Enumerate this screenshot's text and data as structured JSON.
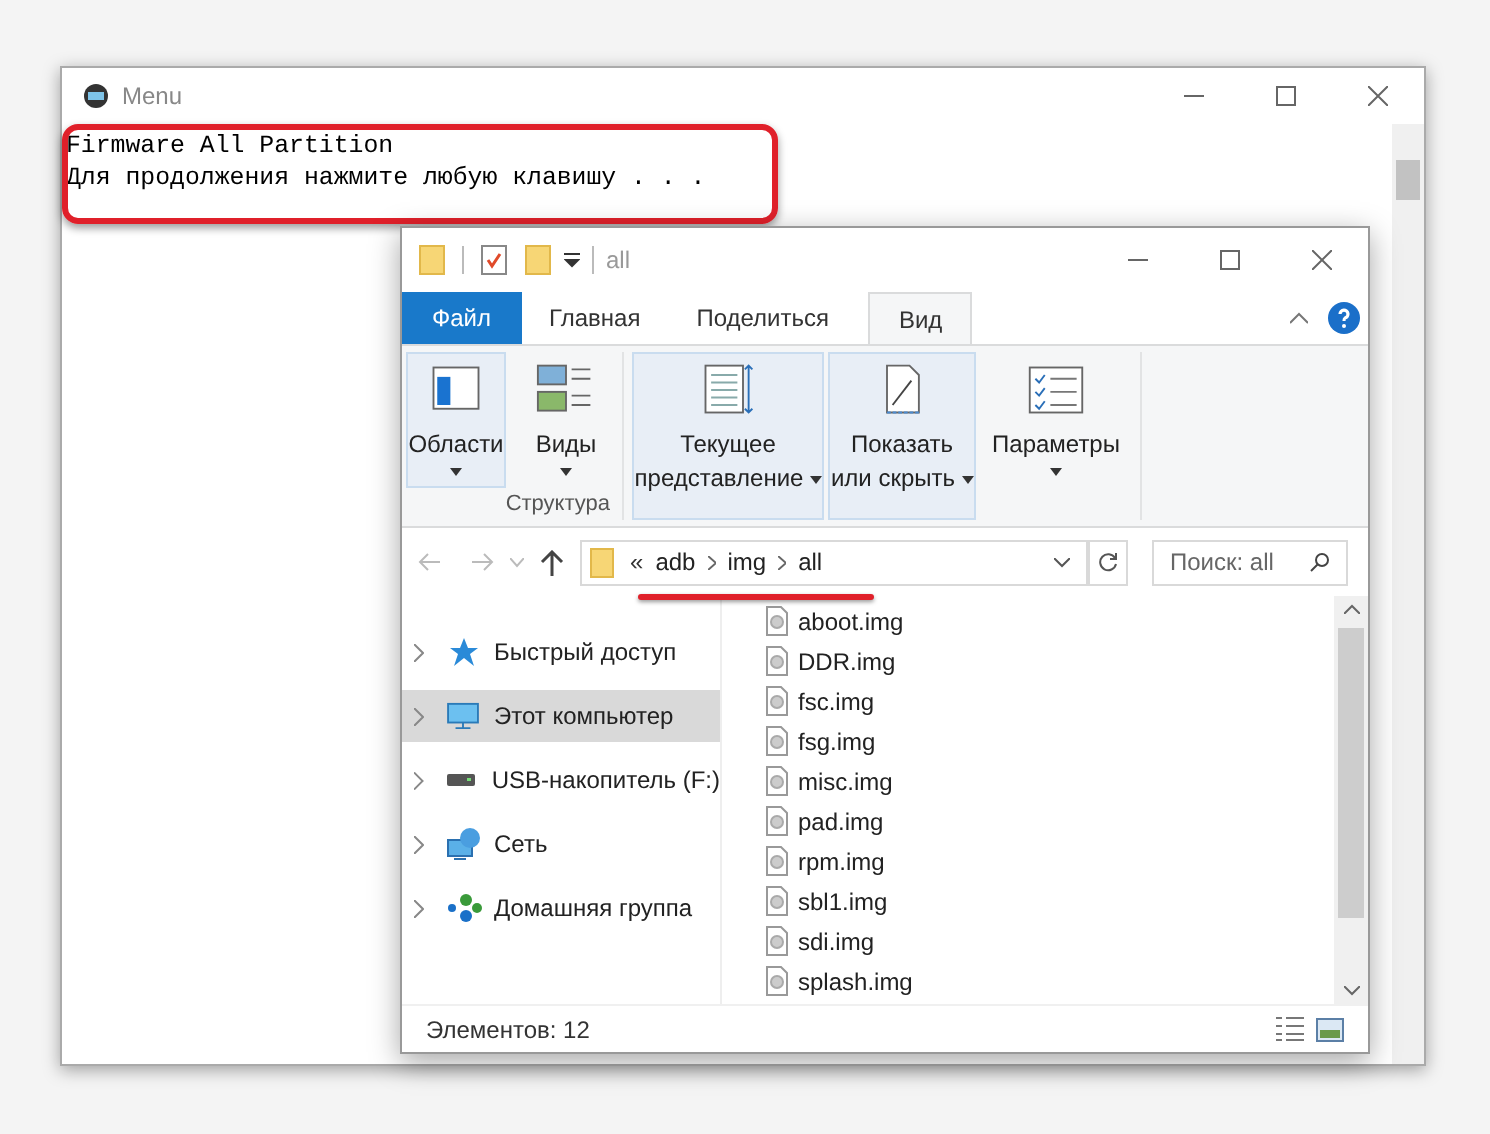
{
  "console": {
    "title": "Menu",
    "lines": [
      "Firmware All Partition",
      "Для продолжения нажмите любую клавишу . . ."
    ]
  },
  "explorer": {
    "title": "all",
    "ribbon_tabs": [
      {
        "label": "Файл",
        "kind": "file",
        "selected": false
      },
      {
        "label": "Главная",
        "kind": "tab",
        "selected": false
      },
      {
        "label": "Поделиться",
        "kind": "tab",
        "selected": false
      },
      {
        "label": "Вид",
        "kind": "tab",
        "selected": true
      }
    ],
    "ribbon_buttons": [
      {
        "lines": [
          "Области"
        ],
        "selected": true
      },
      {
        "lines": [
          "Виды"
        ],
        "selected": false
      },
      {
        "lines": [
          "Текущее",
          "представление"
        ],
        "selected": true
      },
      {
        "lines": [
          "Показать",
          "или скрыть"
        ],
        "selected": true
      },
      {
        "lines": [
          "Параметры"
        ],
        "selected": false
      }
    ],
    "group_label": "Структура",
    "address": {
      "prefix": "«",
      "path": [
        "adb",
        "img",
        "all"
      ]
    },
    "search": {
      "placeholder": "Поиск: all"
    },
    "nav": [
      {
        "label": "Быстрый доступ",
        "selected": false
      },
      {
        "label": "Этот компьютер",
        "selected": true
      },
      {
        "label": "USB-накопитель (F:)",
        "selected": false
      },
      {
        "label": "Сеть",
        "selected": false
      },
      {
        "label": "Домашняя группа",
        "selected": false
      }
    ],
    "files": [
      "aboot.img",
      "DDR.img",
      "fsc.img",
      "fsg.img",
      "misc.img",
      "pad.img",
      "rpm.img",
      "sbl1.img",
      "sdi.img",
      "splash.img"
    ],
    "status": "Элементов: 12"
  }
}
